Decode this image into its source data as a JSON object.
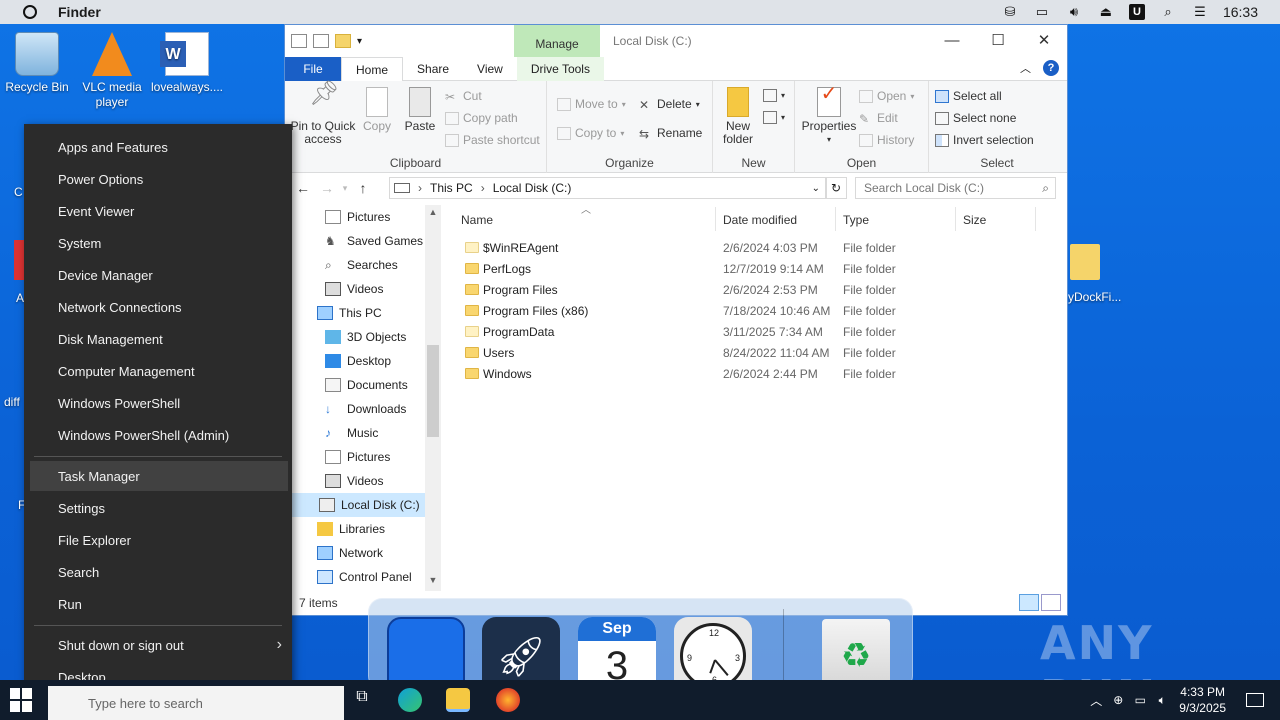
{
  "topbar": {
    "app_name": "Finder",
    "time": "16:33",
    "u_badge": "U"
  },
  "desktop_icons": [
    {
      "label": "Recycle Bin"
    },
    {
      "label": "VLC media player"
    },
    {
      "label": "lovealways...."
    }
  ],
  "desktop_fragments": {
    "right_label": "yDockFi...",
    "left_a": "A",
    "left_diff": "diff",
    "left_c": "C",
    "left_f": "F"
  },
  "explorer": {
    "manage_tab": "Manage",
    "title": "Local Disk (C:)",
    "tabs": [
      "File",
      "Home",
      "Share",
      "View",
      "Drive Tools"
    ],
    "ribbon": {
      "clipboard": {
        "title": "Clipboard",
        "pin": "Pin to Quick access",
        "copy": "Copy",
        "paste": "Paste",
        "cut": "Cut",
        "copy_path": "Copy path",
        "paste_shortcut": "Paste shortcut"
      },
      "organize": {
        "title": "Organize",
        "move_to": "Move to",
        "copy_to": "Copy to",
        "delete": "Delete",
        "rename": "Rename"
      },
      "new": {
        "title": "New",
        "new_folder": "New folder"
      },
      "open": {
        "title": "Open",
        "properties": "Properties",
        "open": "Open",
        "edit": "Edit",
        "history": "History"
      },
      "select": {
        "title": "Select",
        "select_all": "Select all",
        "select_none": "Select none",
        "invert": "Invert selection"
      }
    },
    "address": {
      "crumbs": [
        "This PC",
        "Local Disk (C:)"
      ],
      "search_placeholder": "Search Local Disk (C:)"
    },
    "nav_items": [
      {
        "label": "Pictures"
      },
      {
        "label": "Saved Games"
      },
      {
        "label": "Searches"
      },
      {
        "label": "Videos"
      },
      {
        "label": "This PC"
      },
      {
        "label": "3D Objects"
      },
      {
        "label": "Desktop"
      },
      {
        "label": "Documents"
      },
      {
        "label": "Downloads"
      },
      {
        "label": "Music"
      },
      {
        "label": "Pictures"
      },
      {
        "label": "Videos"
      },
      {
        "label": "Local Disk (C:)"
      },
      {
        "label": "Libraries"
      },
      {
        "label": "Network"
      },
      {
        "label": "Control Panel"
      }
    ],
    "columns": [
      "Name",
      "Date modified",
      "Type",
      "Size"
    ],
    "files": [
      {
        "name": "$WinREAgent",
        "date": "2/6/2024 4:03 PM",
        "type": "File folder"
      },
      {
        "name": "PerfLogs",
        "date": "12/7/2019 9:14 AM",
        "type": "File folder"
      },
      {
        "name": "Program Files",
        "date": "2/6/2024 2:53 PM",
        "type": "File folder"
      },
      {
        "name": "Program Files (x86)",
        "date": "7/18/2024 10:46 AM",
        "type": "File folder"
      },
      {
        "name": "ProgramData",
        "date": "3/11/2025 7:34 AM",
        "type": "File folder"
      },
      {
        "name": "Users",
        "date": "8/24/2022 11:04 AM",
        "type": "File folder"
      },
      {
        "name": "Windows",
        "date": "2/6/2024 2:44 PM",
        "type": "File folder"
      }
    ],
    "status": "7 items"
  },
  "winx_menu": [
    "Apps and Features",
    "Power Options",
    "Event Viewer",
    "System",
    "Device Manager",
    "Network Connections",
    "Disk Management",
    "Computer Management",
    "Windows PowerShell",
    "Windows PowerShell (Admin)",
    "Task Manager",
    "Settings",
    "File Explorer",
    "Search",
    "Run",
    "Shut down or sign out",
    "Desktop"
  ],
  "dock": {
    "calendar_month": "Sep",
    "calendar_day": "3"
  },
  "watermark": "ANY RUN",
  "taskbar": {
    "search_placeholder": "Type here to search",
    "time": "4:33 PM",
    "date": "9/3/2025"
  },
  "colors": {
    "desktop": "#0b62d6",
    "accent": "#1a5fc6",
    "manage_tab": "#bfe8b9",
    "menu_bg": "#2b2b2b",
    "taskbar": "#101c2c"
  }
}
